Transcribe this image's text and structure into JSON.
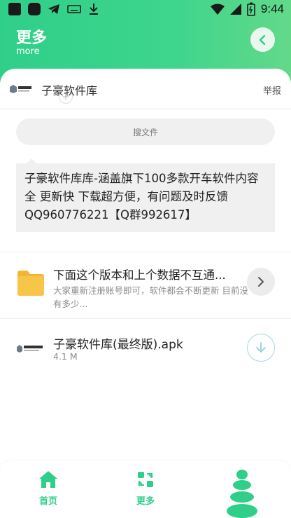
{
  "status_bar": {
    "time": "9:44"
  },
  "header": {
    "title": "更多",
    "subtitle": "more"
  },
  "owner": {
    "name": "子豪软件库",
    "report_label": "举报"
  },
  "search": {
    "label": "搜文件"
  },
  "description": "子豪软件库库-涵盖旗下100多款开车软件内容全 更新快 下载超方便，有问题及时反馈QQ960776221【Q群992617】",
  "files": [
    {
      "type": "folder",
      "title": "下面这个版本和上个数据不互通...",
      "desc": "大家重新注册账号即可，软件都会不断更新 目前没有多少..."
    },
    {
      "type": "apk",
      "name": "子豪软件库(最终版).apk",
      "size": "4.1 M"
    }
  ],
  "tabbar": {
    "tabs": [
      {
        "label": "首页",
        "icon": "home-icon"
      },
      {
        "label": "更多",
        "icon": "switch-icon"
      }
    ]
  },
  "colors": {
    "accent": "#2fcf8a",
    "folder": "#f7c54a"
  }
}
